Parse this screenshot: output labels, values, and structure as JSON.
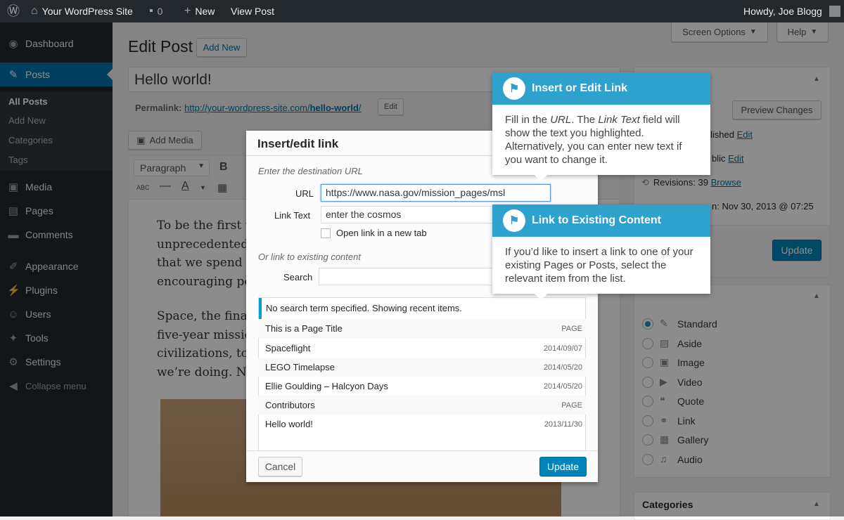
{
  "adminbar": {
    "site": "Your WordPress Site",
    "comments": "0",
    "new": "New",
    "view": "View Post",
    "howdy": "Howdy, Joe Blogg"
  },
  "sidebar": {
    "items": [
      {
        "label": "Dashboard",
        "icon": "dashboard-icon"
      },
      {
        "label": "Posts",
        "icon": "pin-icon"
      },
      {
        "label": "Media",
        "icon": "media-icon"
      },
      {
        "label": "Pages",
        "icon": "pages-icon"
      },
      {
        "label": "Comments",
        "icon": "comments-icon"
      },
      {
        "label": "Appearance",
        "icon": "brush-icon"
      },
      {
        "label": "Plugins",
        "icon": "plugin-icon"
      },
      {
        "label": "Users",
        "icon": "users-icon"
      },
      {
        "label": "Tools",
        "icon": "wrench-icon"
      },
      {
        "label": "Settings",
        "icon": "settings-icon"
      },
      {
        "label": "Collapse menu",
        "icon": "collapse-icon"
      }
    ],
    "submenu": [
      "All Posts",
      "Add New",
      "Categories",
      "Tags"
    ]
  },
  "header": {
    "title": "Edit Post",
    "add_new": "Add New",
    "screen_options": "Screen Options",
    "help": "Help"
  },
  "post": {
    "title": "Hello world!",
    "permalink_label": "Permalink:",
    "permalink_base": "http://your-wordpress-site.com/",
    "permalink_slug": "hello-world",
    "permalink_end": "/",
    "edit": "Edit",
    "add_media": "Add Media",
    "paragraph": "Paragraph",
    "para1": [
      "To be the first to",
      "unprecedented d",
      "that we spend mo",
      "encouraging peo"
    ],
    "para2": [
      "Space, the final fr",
      "five-year mission",
      "civilizations, to bo",
      "we’re doing. Now"
    ]
  },
  "publish": {
    "preview": "Preview Changes",
    "status_suffix": "lished",
    "status_edit": "Edit",
    "visibility_suffix": "blic",
    "visibility_edit": "Edit",
    "revisions": "Revisions: 39",
    "browse": "Browse",
    "published": "n: Nov 30, 2013 @ 07:25",
    "update": "Update"
  },
  "format": {
    "options": [
      "Standard",
      "Aside",
      "Image",
      "Video",
      "Quote",
      "Link",
      "Gallery",
      "Audio"
    ]
  },
  "categories": {
    "title": "Categories"
  },
  "modal": {
    "title": "Insert/edit link",
    "dest_label": "Enter the destination URL",
    "url_label": "URL",
    "url_value": "https://www.nasa.gov/mission_pages/msl",
    "text_label": "Link Text",
    "text_value": "enter the cosmos",
    "new_tab": "Open link in a new tab",
    "existing": "Or link to existing content",
    "search_label": "Search",
    "notice": "No search term specified. Showing recent items.",
    "items": [
      {
        "title": "This is a Page Title",
        "meta": "PAGE"
      },
      {
        "title": "Spaceflight",
        "meta": "2014/09/07"
      },
      {
        "title": "LEGO Timelapse",
        "meta": "2014/05/20"
      },
      {
        "title": "Ellie Goulding – Halcyon Days",
        "meta": "2014/05/20"
      },
      {
        "title": "Contributors",
        "meta": "PAGE"
      },
      {
        "title": "Hello world!",
        "meta": "2013/11/30"
      }
    ],
    "cancel": "Cancel",
    "update": "Update"
  },
  "tips": {
    "t1_title": "Insert or Edit Link",
    "t1_a": "Fill in the ",
    "t1_url": "URL",
    "t1_b": ". The ",
    "t1_lt": "Link Text",
    "t1_c": " field will show the text you highlighted. Alternatively, you can enter new text if you want to change it.",
    "t2_title": "Link to Existing Content",
    "t2_body": "If you’d like to insert a link to one of your existing Pages or Posts, select the relevant item from the list."
  },
  "colors": {
    "accent": "#0073aa",
    "tip": "#2ea2cc",
    "adminbar": "#23282d"
  }
}
